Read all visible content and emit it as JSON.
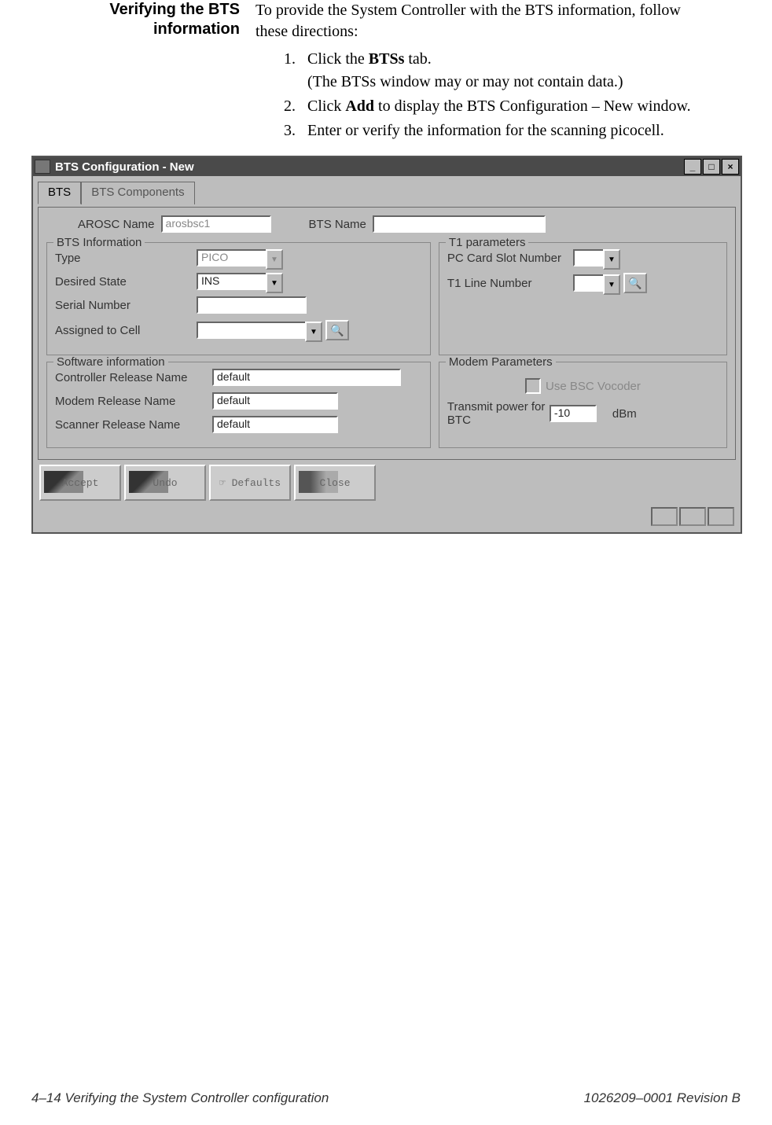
{
  "heading": {
    "line1": "Verifying the BTS",
    "line2": "information"
  },
  "intro": "To provide the System Controller with the BTS information, follow these directions:",
  "steps": [
    {
      "pre": "Click the ",
      "bold": "BTSs",
      "post": " tab.",
      "sub": "(The BTSs window may or may not contain data.)"
    },
    {
      "pre": "Click ",
      "bold": "Add",
      "post": " to display the BTS Configuration – New window."
    },
    {
      "pre": "Enter or verify the information for the scanning picocell.",
      "bold": "",
      "post": ""
    }
  ],
  "window": {
    "title": "BTS Configuration - New",
    "tabs": {
      "active": "BTS",
      "inactive": "BTS Components"
    },
    "top": {
      "arosc_label": "AROSC Name",
      "arosc_value": "arosbsc1",
      "btsname_label": "BTS Name",
      "btsname_value": ""
    },
    "btsinfo": {
      "legend": "BTS Information",
      "type_label": "Type",
      "type_value": "PICO",
      "state_label": "Desired State",
      "state_value": "INS",
      "serial_label": "Serial Number",
      "serial_value": "",
      "cell_label": "Assigned to Cell",
      "cell_value": ""
    },
    "t1": {
      "legend": "T1 parameters",
      "slot_label": "PC Card Slot Number",
      "slot_value": "",
      "line_label": "T1 Line Number",
      "line_value": ""
    },
    "sw": {
      "legend": "Software information",
      "ctrl_label": "Controller Release Name",
      "ctrl_value": "default",
      "modem_label": "Modem Release Name",
      "modem_value": "default",
      "scan_label": "Scanner Release Name",
      "scan_value": "default"
    },
    "modem": {
      "legend": "Modem Parameters",
      "vocoder_label": "Use BSC Vocoder",
      "tx_label": "Transmit power for BTC",
      "tx_value": "-10",
      "tx_unit": "dBm"
    },
    "buttons": {
      "accept": "Accept",
      "undo": "Undo",
      "defaults": "Defaults",
      "close": "Close"
    }
  },
  "footer": {
    "left": "4–14  Verifying the System Controller configuration",
    "right": "1026209–0001  Revision B"
  }
}
